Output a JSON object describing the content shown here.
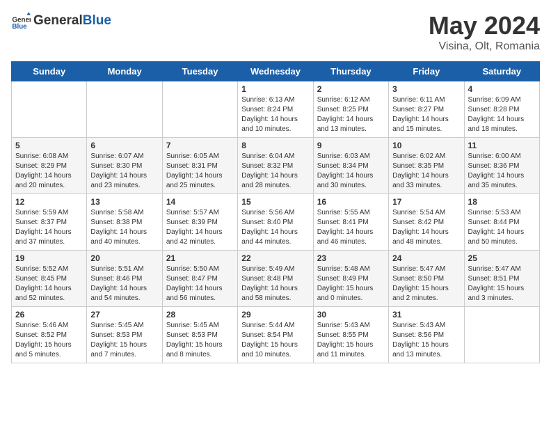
{
  "header": {
    "logo_general": "General",
    "logo_blue": "Blue",
    "month": "May 2024",
    "location": "Visina, Olt, Romania"
  },
  "weekdays": [
    "Sunday",
    "Monday",
    "Tuesday",
    "Wednesday",
    "Thursday",
    "Friday",
    "Saturday"
  ],
  "weeks": [
    [
      {
        "day": "",
        "info": ""
      },
      {
        "day": "",
        "info": ""
      },
      {
        "day": "",
        "info": ""
      },
      {
        "day": "1",
        "info": "Sunrise: 6:13 AM\nSunset: 8:24 PM\nDaylight: 14 hours\nand 10 minutes."
      },
      {
        "day": "2",
        "info": "Sunrise: 6:12 AM\nSunset: 8:25 PM\nDaylight: 14 hours\nand 13 minutes."
      },
      {
        "day": "3",
        "info": "Sunrise: 6:11 AM\nSunset: 8:27 PM\nDaylight: 14 hours\nand 15 minutes."
      },
      {
        "day": "4",
        "info": "Sunrise: 6:09 AM\nSunset: 8:28 PM\nDaylight: 14 hours\nand 18 minutes."
      }
    ],
    [
      {
        "day": "5",
        "info": "Sunrise: 6:08 AM\nSunset: 8:29 PM\nDaylight: 14 hours\nand 20 minutes."
      },
      {
        "day": "6",
        "info": "Sunrise: 6:07 AM\nSunset: 8:30 PM\nDaylight: 14 hours\nand 23 minutes."
      },
      {
        "day": "7",
        "info": "Sunrise: 6:05 AM\nSunset: 8:31 PM\nDaylight: 14 hours\nand 25 minutes."
      },
      {
        "day": "8",
        "info": "Sunrise: 6:04 AM\nSunset: 8:32 PM\nDaylight: 14 hours\nand 28 minutes."
      },
      {
        "day": "9",
        "info": "Sunrise: 6:03 AM\nSunset: 8:34 PM\nDaylight: 14 hours\nand 30 minutes."
      },
      {
        "day": "10",
        "info": "Sunrise: 6:02 AM\nSunset: 8:35 PM\nDaylight: 14 hours\nand 33 minutes."
      },
      {
        "day": "11",
        "info": "Sunrise: 6:00 AM\nSunset: 8:36 PM\nDaylight: 14 hours\nand 35 minutes."
      }
    ],
    [
      {
        "day": "12",
        "info": "Sunrise: 5:59 AM\nSunset: 8:37 PM\nDaylight: 14 hours\nand 37 minutes."
      },
      {
        "day": "13",
        "info": "Sunrise: 5:58 AM\nSunset: 8:38 PM\nDaylight: 14 hours\nand 40 minutes."
      },
      {
        "day": "14",
        "info": "Sunrise: 5:57 AM\nSunset: 8:39 PM\nDaylight: 14 hours\nand 42 minutes."
      },
      {
        "day": "15",
        "info": "Sunrise: 5:56 AM\nSunset: 8:40 PM\nDaylight: 14 hours\nand 44 minutes."
      },
      {
        "day": "16",
        "info": "Sunrise: 5:55 AM\nSunset: 8:41 PM\nDaylight: 14 hours\nand 46 minutes."
      },
      {
        "day": "17",
        "info": "Sunrise: 5:54 AM\nSunset: 8:42 PM\nDaylight: 14 hours\nand 48 minutes."
      },
      {
        "day": "18",
        "info": "Sunrise: 5:53 AM\nSunset: 8:44 PM\nDaylight: 14 hours\nand 50 minutes."
      }
    ],
    [
      {
        "day": "19",
        "info": "Sunrise: 5:52 AM\nSunset: 8:45 PM\nDaylight: 14 hours\nand 52 minutes."
      },
      {
        "day": "20",
        "info": "Sunrise: 5:51 AM\nSunset: 8:46 PM\nDaylight: 14 hours\nand 54 minutes."
      },
      {
        "day": "21",
        "info": "Sunrise: 5:50 AM\nSunset: 8:47 PM\nDaylight: 14 hours\nand 56 minutes."
      },
      {
        "day": "22",
        "info": "Sunrise: 5:49 AM\nSunset: 8:48 PM\nDaylight: 14 hours\nand 58 minutes."
      },
      {
        "day": "23",
        "info": "Sunrise: 5:48 AM\nSunset: 8:49 PM\nDaylight: 15 hours\nand 0 minutes."
      },
      {
        "day": "24",
        "info": "Sunrise: 5:47 AM\nSunset: 8:50 PM\nDaylight: 15 hours\nand 2 minutes."
      },
      {
        "day": "25",
        "info": "Sunrise: 5:47 AM\nSunset: 8:51 PM\nDaylight: 15 hours\nand 3 minutes."
      }
    ],
    [
      {
        "day": "26",
        "info": "Sunrise: 5:46 AM\nSunset: 8:52 PM\nDaylight: 15 hours\nand 5 minutes."
      },
      {
        "day": "27",
        "info": "Sunrise: 5:45 AM\nSunset: 8:53 PM\nDaylight: 15 hours\nand 7 minutes."
      },
      {
        "day": "28",
        "info": "Sunrise: 5:45 AM\nSunset: 8:53 PM\nDaylight: 15 hours\nand 8 minutes."
      },
      {
        "day": "29",
        "info": "Sunrise: 5:44 AM\nSunset: 8:54 PM\nDaylight: 15 hours\nand 10 minutes."
      },
      {
        "day": "30",
        "info": "Sunrise: 5:43 AM\nSunset: 8:55 PM\nDaylight: 15 hours\nand 11 minutes."
      },
      {
        "day": "31",
        "info": "Sunrise: 5:43 AM\nSunset: 8:56 PM\nDaylight: 15 hours\nand 13 minutes."
      },
      {
        "day": "",
        "info": ""
      }
    ]
  ]
}
